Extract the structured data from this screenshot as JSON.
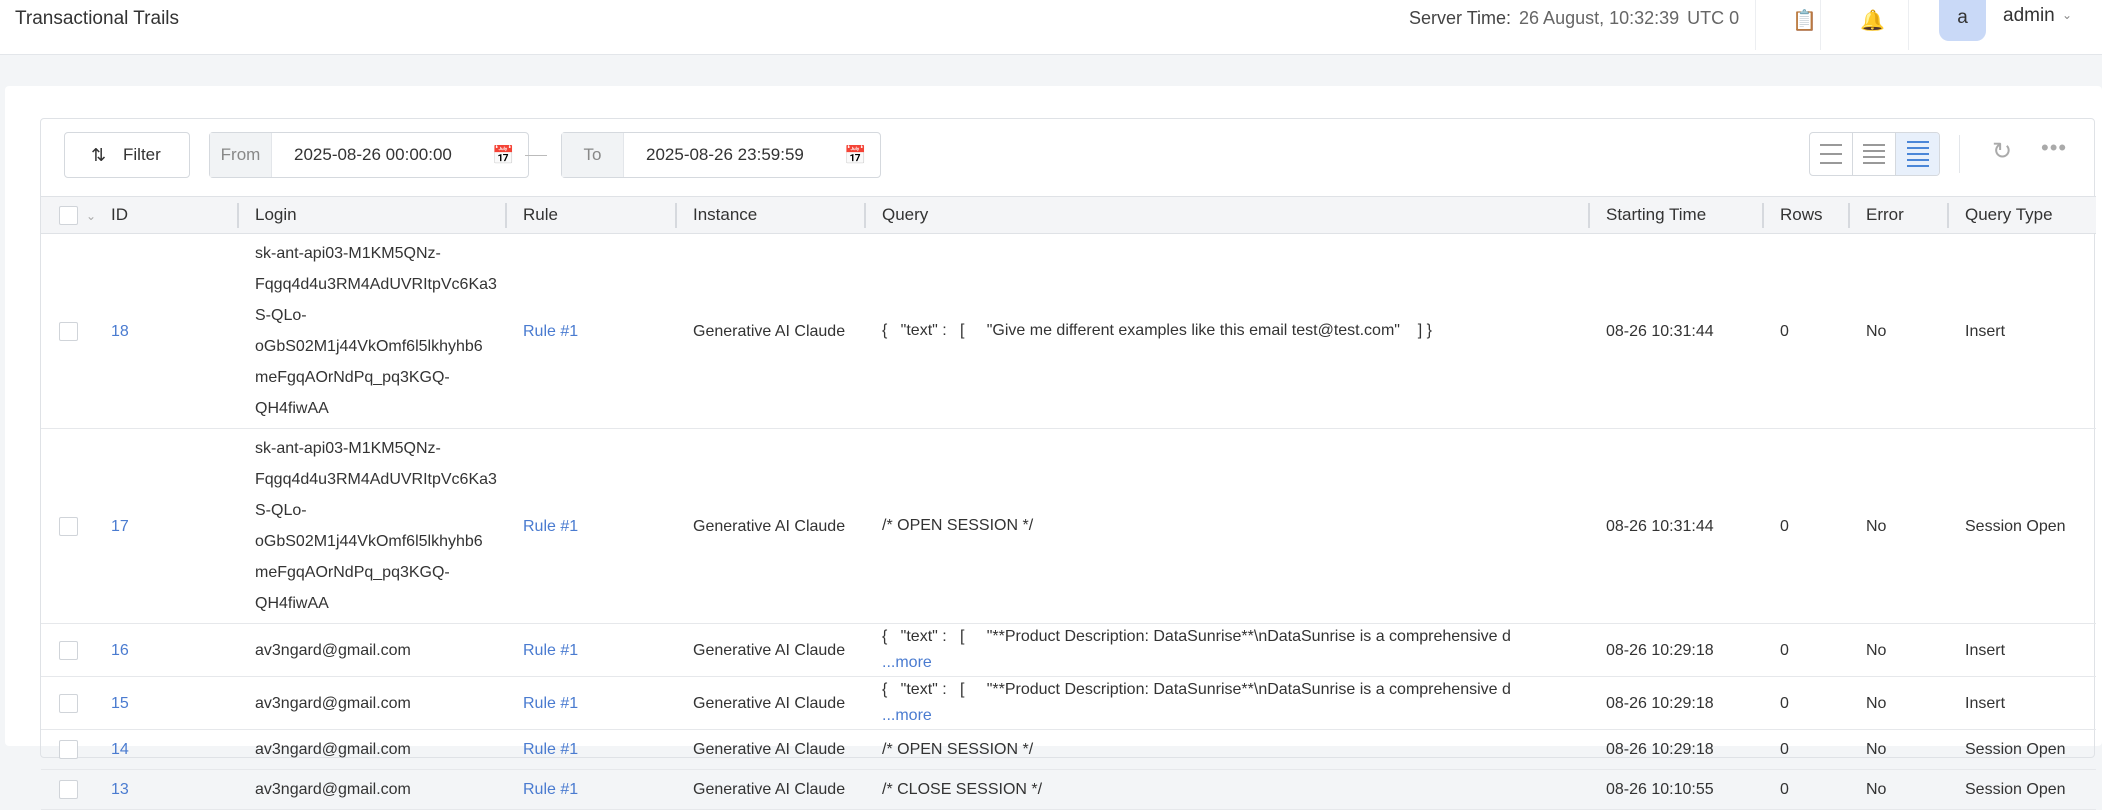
{
  "header": {
    "title": "Transactional Trails",
    "server_time_label": "Server Time:",
    "server_time_value": "26 August, 10:32:39",
    "timezone": "UTC 0",
    "avatar_letter": "a",
    "username": "admin"
  },
  "toolbar": {
    "filter_label": "Filter",
    "from_label": "From",
    "from_value": "2025-08-26 00:00:00",
    "to_label": "To",
    "to_value": "2025-08-26 23:59:59"
  },
  "table": {
    "columns": [
      "ID",
      "Login",
      "Rule",
      "Instance",
      "Query",
      "Starting Time",
      "Rows",
      "Error",
      "Query Type"
    ],
    "more_label": "...more",
    "rows": [
      {
        "id": "18",
        "login": [
          "sk-ant-api03-M1KM5QNz-",
          "Fqgq4d4u3RM4AdUVRItpVc6Ka3",
          "S-QLo-",
          "oGbS02M1j44VkOmf6l5lkhyhb6",
          "meFgqAOrNdPq_pq3KGQ-",
          "QH4fiwAA"
        ],
        "rule": "Rule #1",
        "instance": "Generative AI Claude",
        "query": "{   \"text\" :   [     \"Give me different examples like this email test@test.com\"    ] }",
        "more": false,
        "start": "08-26 10:31:44",
        "rows": "0",
        "error": "No",
        "type": "Insert"
      },
      {
        "id": "17",
        "login": [
          "sk-ant-api03-M1KM5QNz-",
          "Fqgq4d4u3RM4AdUVRItpVc6Ka3",
          "S-QLo-",
          "oGbS02M1j44VkOmf6l5lkhyhb6",
          "meFgqAOrNdPq_pq3KGQ-",
          "QH4fiwAA"
        ],
        "rule": "Rule #1",
        "instance": "Generative AI Claude",
        "query": "/* OPEN SESSION */",
        "more": false,
        "start": "08-26 10:31:44",
        "rows": "0",
        "error": "No",
        "type": "Session Open"
      },
      {
        "id": "16",
        "login": [
          "av3ngard@gmail.com"
        ],
        "rule": "Rule #1",
        "instance": "Generative AI Claude",
        "query": "{   \"text\" :   [     \"**Product Description: DataSunrise**\\nDataSunrise is a comprehensive d",
        "more": true,
        "start": "08-26 10:29:18",
        "rows": "0",
        "error": "No",
        "type": "Insert"
      },
      {
        "id": "15",
        "login": [
          "av3ngard@gmail.com"
        ],
        "rule": "Rule #1",
        "instance": "Generative AI Claude",
        "query": "{   \"text\" :   [     \"**Product Description: DataSunrise**\\nDataSunrise is a comprehensive d",
        "more": true,
        "start": "08-26 10:29:18",
        "rows": "0",
        "error": "No",
        "type": "Insert"
      },
      {
        "id": "14",
        "login": [
          "av3ngard@gmail.com"
        ],
        "rule": "Rule #1",
        "instance": "Generative AI Claude",
        "query": "/* OPEN SESSION */",
        "more": false,
        "start": "08-26 10:29:18",
        "rows": "0",
        "error": "No",
        "type": "Session Open"
      },
      {
        "id": "13",
        "login": [
          "av3ngard@gmail.com"
        ],
        "rule": "Rule #1",
        "instance": "Generative AI Claude",
        "query": "/* CLOSE SESSION */",
        "more": false,
        "start": "08-26 10:10:55",
        "rows": "0",
        "error": "No",
        "type": "Session Open"
      }
    ]
  }
}
